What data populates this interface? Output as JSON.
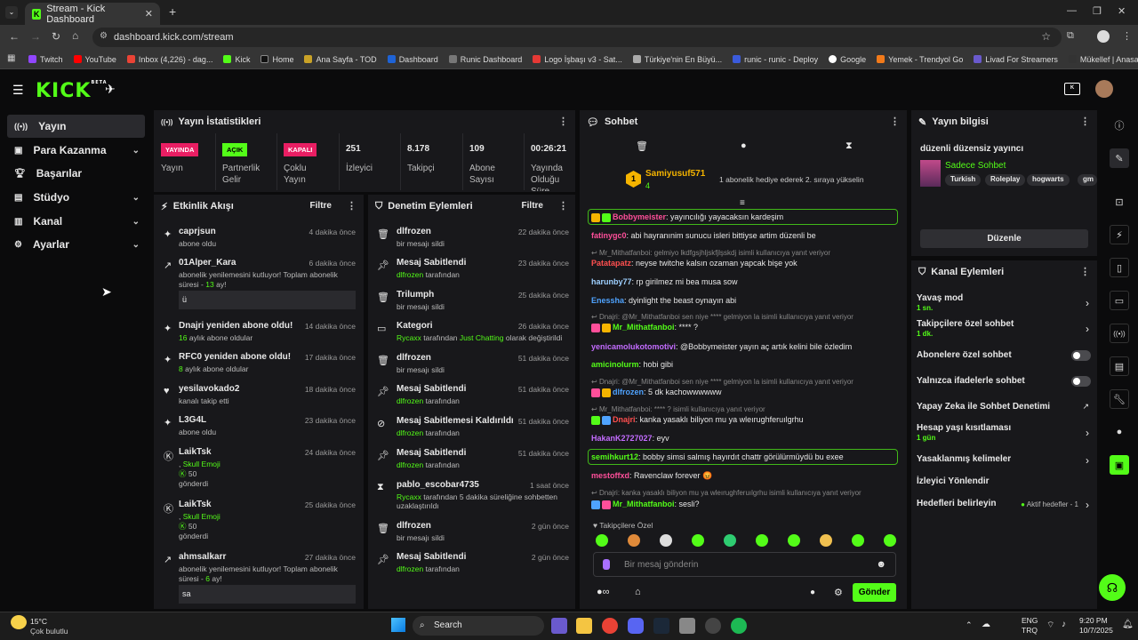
{
  "browser": {
    "tab_title": "Stream - Kick Dashboard",
    "url": "dashboard.kick.com/stream",
    "bookmarks": [
      "Twitch",
      "YouTube",
      "Inbox (4,226) - dag...",
      "Kick",
      "Home",
      "Ana Sayfa - TOD",
      "Dashboard",
      "Runic Dashboard",
      "Logo İşbaşı v3 - Sat...",
      "Türkiye'nin En Büyü...",
      "runic - runic - Deploy",
      "Google",
      "Yemek - Trendyol Go",
      "Livad For Streamers",
      "Mükellef | Anasayfa..."
    ]
  },
  "kick": {
    "logo": "KICK",
    "beta": "BETA"
  },
  "sidebar": {
    "items": [
      {
        "label": "Yayın",
        "icon": "broadcast-icon"
      },
      {
        "label": "Para Kazanma",
        "icon": "money-icon"
      },
      {
        "label": "Başarılar",
        "icon": "trophy-icon"
      },
      {
        "label": "Stüdyo",
        "icon": "studio-icon"
      },
      {
        "label": "Kanal",
        "icon": "channel-icon"
      },
      {
        "label": "Ayarlar",
        "icon": "gear-icon"
      }
    ]
  },
  "stats": {
    "title": "Yayın İstatistikleri",
    "cells": [
      {
        "badge": "YAYINDA",
        "label": "Yayın"
      },
      {
        "badge": "AÇIK",
        "label": "Partnerlik Gelir"
      },
      {
        "badge": "KAPALI",
        "label": "Çoklu Yayın"
      },
      {
        "value": "251",
        "label": "İzleyici"
      },
      {
        "value": "8.178",
        "label": "Takipçi"
      },
      {
        "value": "109",
        "label": "Abone Sayısı"
      },
      {
        "value": "00:26:21",
        "label": "Yayında Olduğu Süre"
      }
    ]
  },
  "activity": {
    "title": "Etkinlik Akışı",
    "filter": "Filtre",
    "items": [
      {
        "name": "caprjsun",
        "sub": "abone oldu",
        "when": "4 dakika önce"
      },
      {
        "name": "01Alper_Kara",
        "sub": "abonelik yenilemesini kutluyor! Toplam abonelik süresi -",
        "hl": "13",
        "sub2": "ay!",
        "msg": "ü",
        "when": "6 dakika önce"
      },
      {
        "name": "Dnajri yeniden abone oldu!",
        "hl": "16",
        "sub": "aylık abone oldular",
        "when": "14 dakika önce"
      },
      {
        "name": "RFC0 yeniden abone oldu!",
        "hl": "8",
        "sub": "aylık abone oldular",
        "when": "17 dakika önce"
      },
      {
        "name": "yesilavokado2",
        "sub": "kanalı takip etti",
        "when": "18 dakika önce"
      },
      {
        "name": "L3G4L",
        "sub": "abone oldu",
        "when": "23 dakika önce"
      },
      {
        "name": "LaikTsk",
        "sub": ",",
        "hl": "Skull Emoji",
        "amount": "50",
        "sub2": "gönderdi",
        "when": "24 dakika önce"
      },
      {
        "name": "LaikTsk",
        "sub": ",",
        "hl": "Skull Emoji",
        "amount": "50",
        "sub2": "gönderdi",
        "when": "25 dakika önce"
      },
      {
        "name": "ahmsalkarr",
        "sub": "abonelik yenilemesini kutluyor! Toplam abonelik süresi -",
        "hl": "6",
        "sub2": "ay!",
        "msg": "sa",
        "when": "27 dakika önce"
      }
    ]
  },
  "moderation": {
    "title": "Denetim Eylemleri",
    "filter": "Filtre",
    "items": [
      {
        "name": "dlfrozen",
        "sub": "bir mesajı sildi",
        "when": "22 dakika önce"
      },
      {
        "name": "Mesaj Sabitlendi",
        "hl": "dlfrozen",
        "sub": "tarafından",
        "when": "23 dakika önce"
      },
      {
        "name": "Trilumph",
        "sub": "bir mesajı sildi",
        "when": "25 dakika önce"
      },
      {
        "name": "Kategori",
        "hl": "Rycaxx",
        "sub": "tarafından",
        "hl2": "Just Chatting",
        "sub2": "olarak değiştirildi",
        "when": "26 dakika önce"
      },
      {
        "name": "dlfrozen",
        "sub": "bir mesajı sildi",
        "when": "51 dakika önce"
      },
      {
        "name": "Mesaj Sabitlendi",
        "hl": "dlfrozen",
        "sub": "tarafından",
        "when": "51 dakika önce"
      },
      {
        "name": "Mesaj Sabitlemesi Kaldırıldı",
        "hl": "dlfrozen",
        "sub": "tarafından",
        "when": "51 dakika önce"
      },
      {
        "name": "Mesaj Sabitlendi",
        "hl": "dlfrozen",
        "sub": "tarafından",
        "when": "51 dakika önce"
      },
      {
        "name": "pablo_escobar4735",
        "hl": "Rycaxx",
        "sub": "tarafından 5 dakika süreliğine sohbetten uzaklaştırıldı",
        "when": "1 saat önce"
      },
      {
        "name": "dlfrozen",
        "sub": "bir mesajı sildi",
        "when": "2 gün önce"
      },
      {
        "name": "Mesaj Sabitlendi",
        "hl": "dlfrozen",
        "sub": "tarafından",
        "when": "2 gün önce"
      }
    ]
  },
  "chat": {
    "title": "Sohbet",
    "gift": {
      "user": "Samiyusuf571",
      "count": "4",
      "text": "1 abonelik hediye ederek 2. sıraya yükselin"
    },
    "messages": [
      {
        "user": "Bobbymeister",
        "color": "#ff4f9a",
        "text": ": yayıncılığı yayacaksın kardeşim",
        "box": true
      },
      {
        "user": "fatinygc0",
        "color": "#ff4f9a",
        "text": ": abi hayranınim sunucu isleri bittiyse artim düzenli be"
      },
      {
        "reply": "Mr_Mithatfanboi: gelmiyo lkdfgsjhljskfjlşskdj isimli kullanıcıya yanıt veriyor"
      },
      {
        "user": "Patatapatz",
        "color": "#ff4f4f",
        "text": ": neyse twitche kalsın ozaman yapcak bişe yok"
      },
      {
        "user": "harunby77",
        "color": "#9ed0ff",
        "text": ": rp girilmez mi bea musa sow"
      },
      {
        "user": "Enessha",
        "color": "#4fa3ff",
        "text": ": dyinlight the beast oynayın abi"
      },
      {
        "reply": "Dnajri: @Mr_Mithatfanboi sen niye **** gelmiyon la isimli kullanıcıya yanıt veriyor"
      },
      {
        "user": "Mr_Mithatfanboi",
        "color": "#53fc18",
        "text": ": **** ?"
      },
      {
        "user": "yenicamolukotomotivi",
        "color": "#c36cff",
        "text": ": @Bobbymeister yayın aç artık kelini bile özledim"
      },
      {
        "user": "amicinolurm",
        "color": "#53fc18",
        "text": ": hobi gibi"
      },
      {
        "reply": "Dnajri: @Mr_Mithatfanboi sen niye **** gelmiyon la isimli kullanıcıya yanıt veriyor"
      },
      {
        "user": "dlfrozen",
        "color": "#4fa3ff",
        "text": ": 5 dk kachowwwwww"
      },
      {
        "reply": "Mr_Mithatfanboi: **** ? isimli kullanıcıya yanıt veriyor"
      },
      {
        "user": "Dnajri",
        "color": "#ff4f4f",
        "text": ": kanka yasaklı biliyon mu ya wleırughferuılgrhu"
      },
      {
        "user": "HakanK2727027",
        "color": "#c36cff",
        "text": ": eyv"
      },
      {
        "user": "semihkurt12",
        "color": "#53fc18",
        "text": ": bobby simsi salmış hayırdıt chattr görülürmüydü bu exee",
        "box": true
      },
      {
        "user": "mestoffxd",
        "color": "#ff4f9a",
        "text": ": Ravenclaw forever 😡"
      },
      {
        "reply": "Dnajri: kanka yasaklı biliyon mu ya wleırughferuılgrhu isimli kullanıcıya yanıt veriyor"
      },
      {
        "user": "Mr_Mithatfanboi",
        "color": "#53fc18",
        "text": ": sesli?"
      }
    ],
    "emote_label": "Takipçilere Özel",
    "input_placeholder": "Bir mesaj gönderin",
    "send": "Gönder"
  },
  "stream_info": {
    "title": "Yayın bilgisi",
    "stream_title": "düzenli düzensiz yayıncı",
    "category": "Sadece Sohbet",
    "tags": [
      "Turkish",
      "Roleplay",
      "hogwarts",
      "gm"
    ],
    "edit": "Düzenle"
  },
  "channel_actions": {
    "title": "Kanal Eylemleri",
    "items": [
      {
        "label": "Yavaş mod",
        "sub": "1 sn.",
        "kind": "chevron"
      },
      {
        "label": "Takipçilere özel sohbet",
        "sub": "1 dk.",
        "kind": "chevron"
      },
      {
        "label": "Abonelere özel sohbet",
        "kind": "toggle"
      },
      {
        "label": "Yalnızca ifadelerle sohbet",
        "kind": "toggle"
      },
      {
        "label": "Yapay Zeka ile Sohbet Denetimi",
        "kind": "link"
      },
      {
        "label": "Hesap yaşı kısıtlaması",
        "sub": "1 gün",
        "kind": "chevron"
      },
      {
        "label": "Yasaklanmış kelimeler",
        "kind": "chevron"
      },
      {
        "label": "İzleyici Yönlendir",
        "kind": "none"
      },
      {
        "label": "Hedefleri belirleyin",
        "extra": "Aktif hedefler - 1",
        "kind": "chevron"
      }
    ]
  },
  "taskbar": {
    "temp": "15°C",
    "weather": "Çok bulutlu",
    "search": "Search",
    "lang": "ENG",
    "lang2": "TRQ",
    "time": "9:20 PM",
    "date": "10/7/2025"
  },
  "colors": {
    "accent": "#53fc18",
    "panel": "#18181b",
    "live": "#e91e63"
  }
}
